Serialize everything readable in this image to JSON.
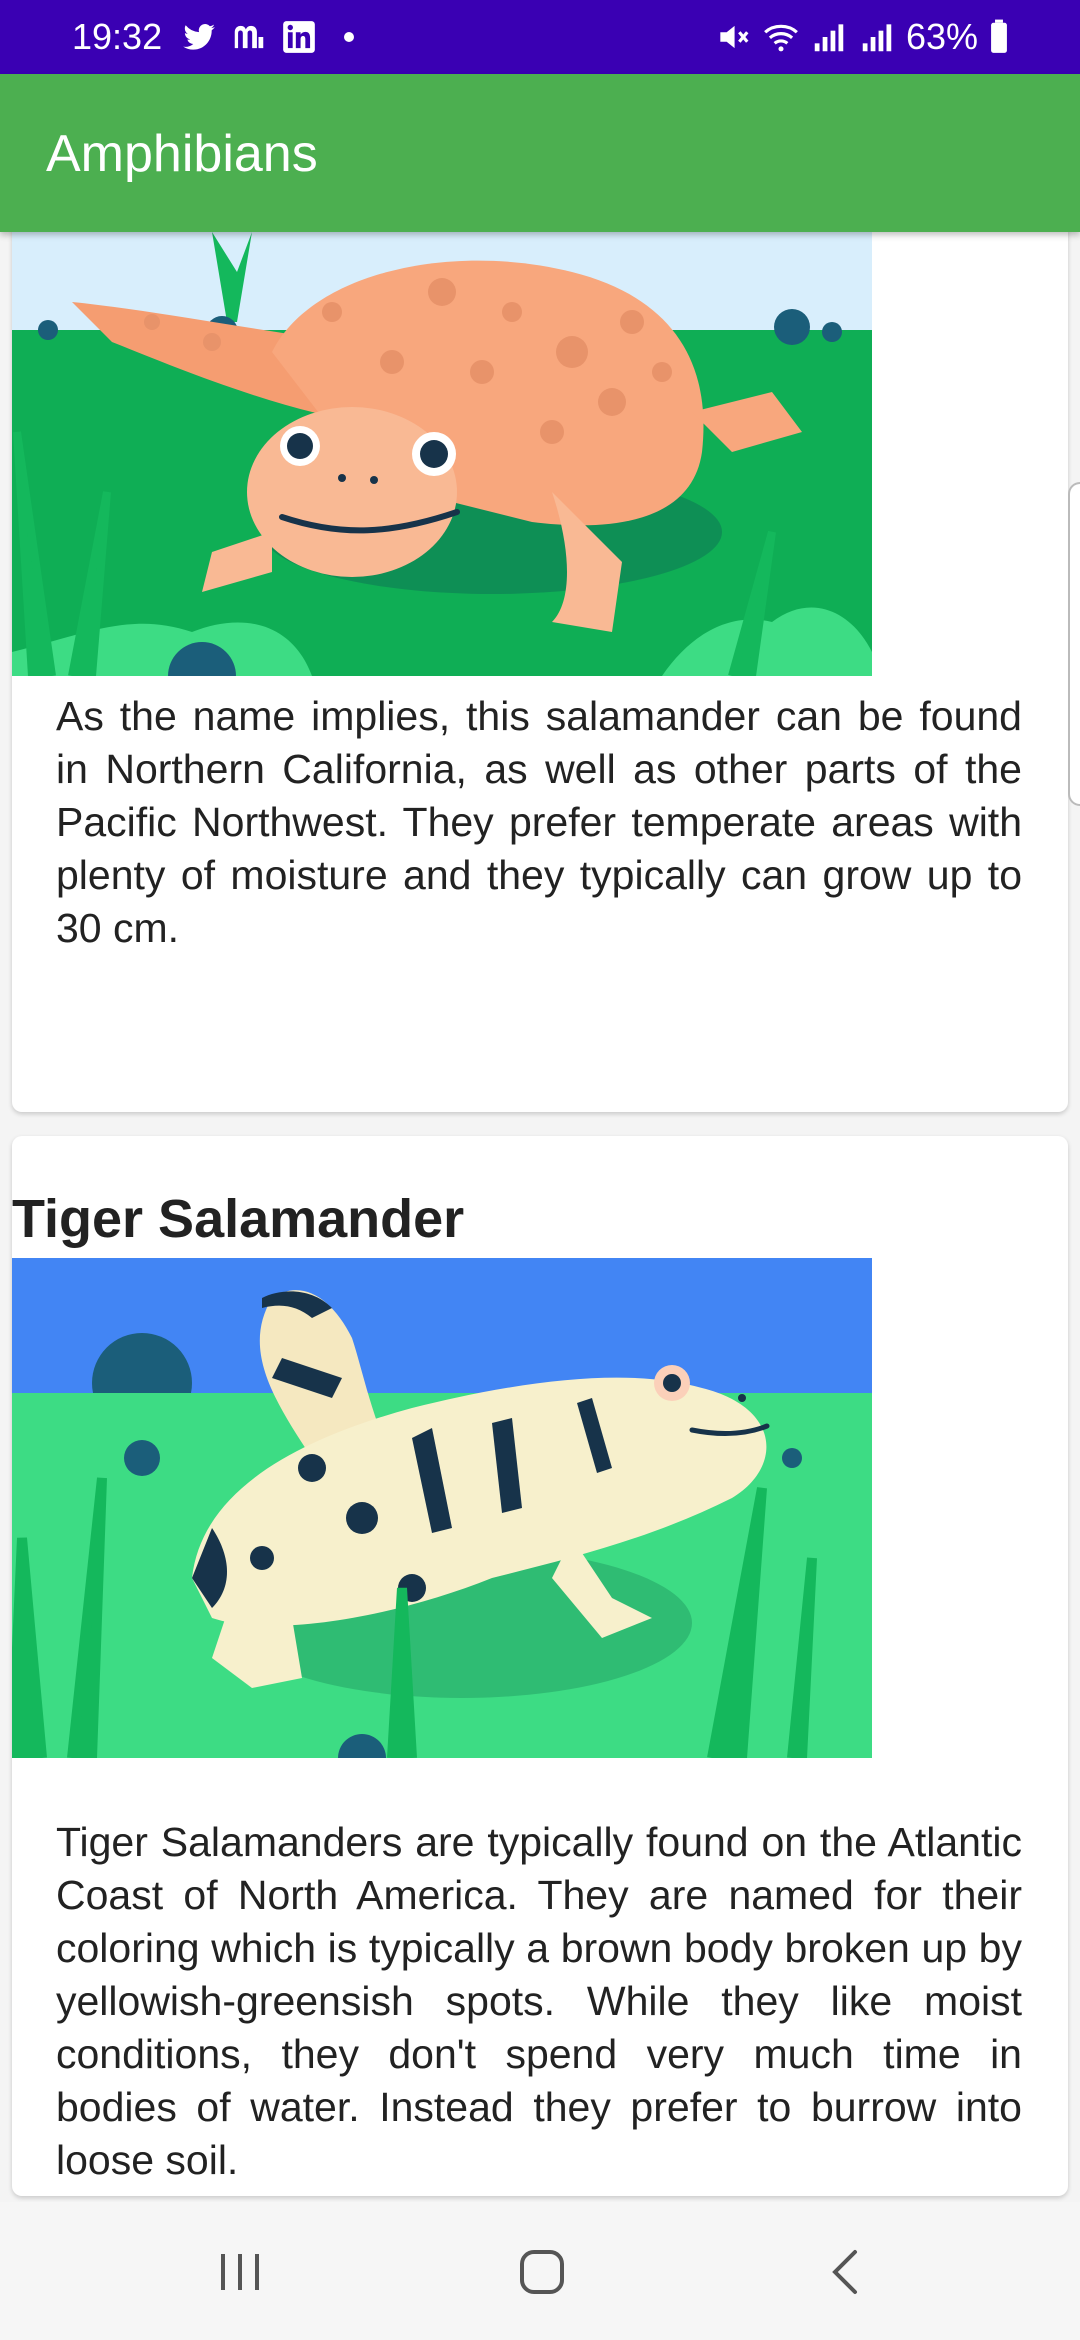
{
  "status_bar": {
    "time": "19:32",
    "battery": "63%",
    "notification_icons": [
      "twitter-icon",
      "mastodon-icon",
      "linkedin-icon",
      "dot-icon"
    ],
    "system_icons": [
      "mute-icon",
      "wifi-icon",
      "signal-icon",
      "signal-icon",
      "battery-icon"
    ]
  },
  "app_bar": {
    "title": "Amphibians"
  },
  "cards": [
    {
      "title": "",
      "image_icon": "salamander-illustration",
      "description": "As the name implies, this salamander can be found in Northern California, as well as other parts of the Pacific Northwest. They prefer temperate areas with plenty of moisture and they typically can grow up to 30 cm."
    },
    {
      "title": "Tiger Salamander",
      "image_icon": "tiger-salamander-illustration",
      "description": "Tiger Salamanders are typically found on the Atlantic Coast of North America. They are named for their coloring which is typically a brown body broken up by yellowish-greensish spots. While they like moist conditions, they don't spend very much time in bodies of water. Instead they prefer to burrow into loose soil."
    }
  ],
  "nav_bar": {
    "icons": [
      "recents-icon",
      "home-icon",
      "back-icon"
    ]
  }
}
